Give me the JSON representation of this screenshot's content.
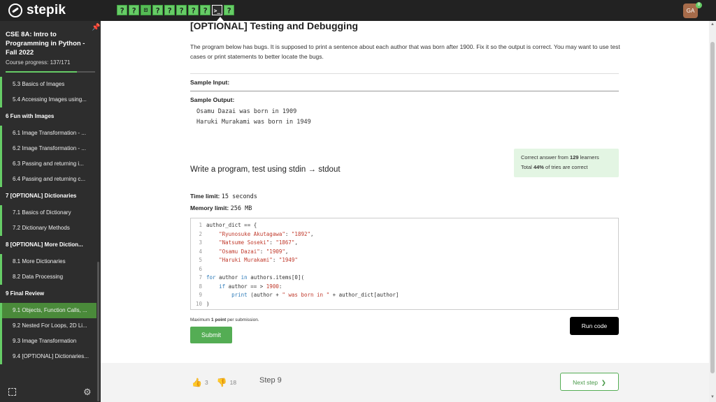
{
  "topbar": {
    "logo_text": "stepik",
    "steps": [
      "?",
      "?",
      "⊡",
      "?",
      "?",
      "?",
      "?",
      "?",
      ">_",
      "?"
    ],
    "avatar_initials": "GA",
    "avatar_badge": "8"
  },
  "sidebar": {
    "course_title": "CSE 8A: Intro to Programming in Python - Fall 2022",
    "course_progress": "Course progress:  137/171",
    "progress_fraction": 0.8,
    "entries": [
      {
        "kind": "lesson",
        "label": "5.3  Basics of Images",
        "active": false
      },
      {
        "kind": "lesson",
        "label": "5.4  Accessing Images using...",
        "active": false
      },
      {
        "kind": "section",
        "label": "6  Fun with Images"
      },
      {
        "kind": "lesson",
        "label": "6.1  Image Transformation - ...",
        "active": false
      },
      {
        "kind": "lesson",
        "label": "6.2  Image Transformation - ...",
        "active": false
      },
      {
        "kind": "lesson",
        "label": "6.3  Passing and returning i...",
        "active": false
      },
      {
        "kind": "lesson",
        "label": "6.4  Passing and returning c...",
        "active": false
      },
      {
        "kind": "section",
        "label": "7  [OPTIONAL] Dictionaries"
      },
      {
        "kind": "lesson",
        "label": "7.1  Basics of Dictionary",
        "active": false
      },
      {
        "kind": "lesson",
        "label": "7.2  Dictionary Methods",
        "active": false
      },
      {
        "kind": "section",
        "label": "8  [OPTIONAL] More Diction..."
      },
      {
        "kind": "lesson",
        "label": "8.1  More Dictionaries",
        "active": false
      },
      {
        "kind": "lesson",
        "label": "8.2  Data Processing",
        "active": false
      },
      {
        "kind": "section",
        "label": "9  Final Review"
      },
      {
        "kind": "lesson",
        "label": "9.1  Objects, Function Calls, ...",
        "active": true
      },
      {
        "kind": "lesson",
        "label": "9.2  Nested For Loops, 2D Li...",
        "active": false
      },
      {
        "kind": "lesson",
        "label": "9.3  Image Transformation",
        "active": false
      },
      {
        "kind": "lesson",
        "label": "9.4  [OPTIONAL] Dictionaries...",
        "active": false
      }
    ]
  },
  "main": {
    "title": "[OPTIONAL] Testing and Debugging",
    "task_text": "The program below has bugs.  It is supposed to print a sentence about each author that was born after 1900.  Fix it so the output is correct.  You may want to use test cases or print statements to better locate the bugs.",
    "sample_input_label": "Sample Input:",
    "sample_output_label": "Sample Output:",
    "sample_output": "Osamu Dazai was born in 1909\nHaruki Murakami was born in 1949",
    "stats_prefix": "Correct answer from ",
    "stats_count": "129",
    "stats_suffix": " learners",
    "stats_total_prefix": "Total ",
    "stats_percent": "44%",
    "stats_total_suffix": " of tries are correct",
    "write_heading": "Write a program, test using stdin → stdout",
    "time_limit_label": "Time limit:",
    "time_limit_value": "15 seconds",
    "memory_limit_label": "Memory limit:",
    "memory_limit_value": "256 MB",
    "code_lines": [
      {
        "n": "1",
        "html": "author_dict == {"
      },
      {
        "n": "2",
        "html": "    <span class=\"tok-str\">\"Ryunosuke Akutagawa\"</span>: <span class=\"tok-str\">\"1892\"</span>,"
      },
      {
        "n": "3",
        "html": "    <span class=\"tok-str\">\"Natsume Soseki\"</span>: <span class=\"tok-str\">\"1867\"</span>,"
      },
      {
        "n": "4",
        "html": "    <span class=\"tok-str\">\"Osamu Dazai\"</span>: <span class=\"tok-str\">\"1909\"</span>,"
      },
      {
        "n": "5",
        "html": "    <span class=\"tok-str\">\"Haruki Murakami\"</span>: <span class=\"tok-str\">\"1949\"</span>"
      },
      {
        "n": "6",
        "html": ""
      },
      {
        "n": "7",
        "html": "<span class=\"tok-kw\">for</span> author <span class=\"tok-kw\">in</span> authors.items[0](<span></span>"
      },
      {
        "n": "8",
        "html": "    <span class=\"tok-kw\">if</span> author == > <span class=\"tok-num\">1900</span>:"
      },
      {
        "n": "9",
        "html": "        <span class=\"tok-kw\">print</span> (author + <span class=\"tok-str\">\" was born in \"</span> + author_dict[author]"
      },
      {
        "n": "10",
        "html": ")"
      }
    ],
    "max_points_prefix": "Maximum ",
    "max_points_value": "1 point",
    "max_points_suffix": " per submission.",
    "run_label": "Run code",
    "submit_label": "Submit"
  },
  "footer": {
    "likes": "3",
    "dislikes": "18",
    "step_label": "Step 9",
    "next_label": "Next step"
  },
  "colors": {
    "accent_green": "#54ad54",
    "topbar": "#222222",
    "sidebar": "#2d2d2d"
  }
}
